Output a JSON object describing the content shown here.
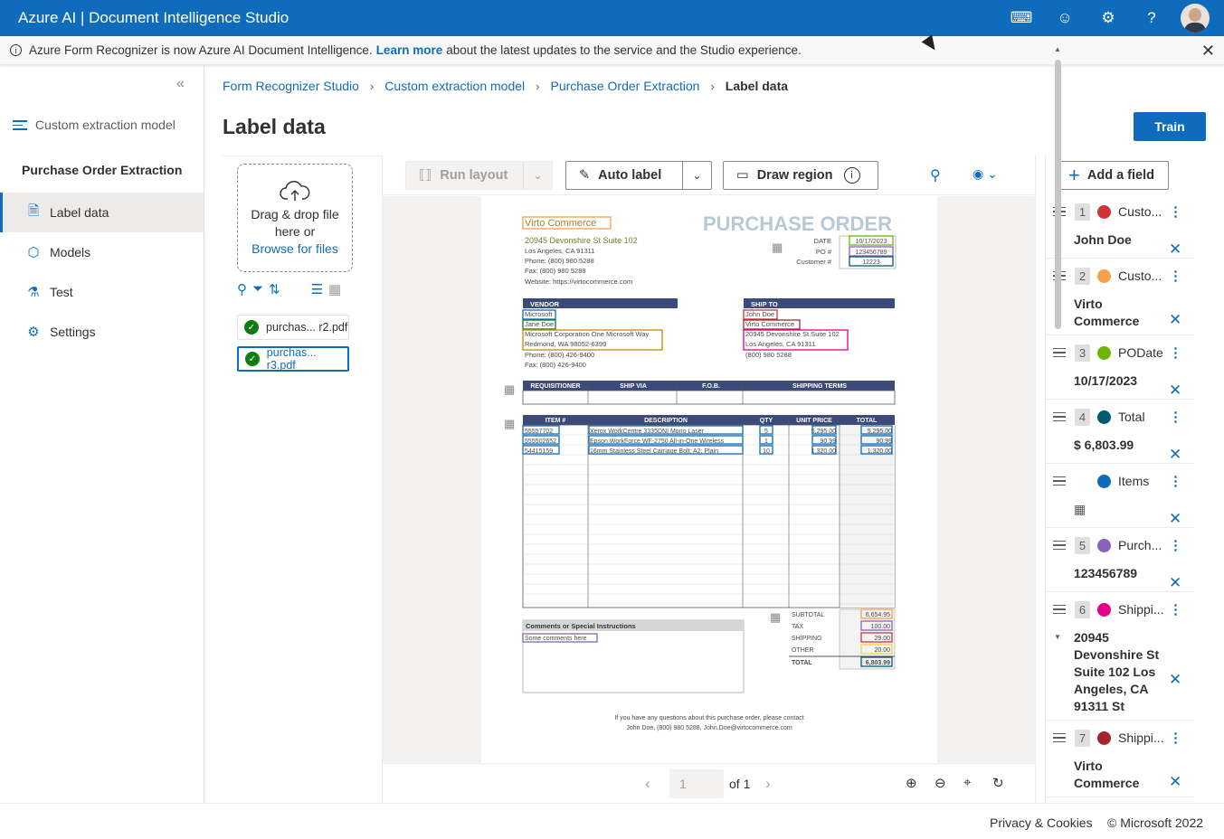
{
  "app": {
    "title": "Azure AI | Document Intelligence Studio"
  },
  "banner": {
    "text_before": "Azure Form Recognizer is now Azure AI Document Intelligence.",
    "link": "Learn more",
    "text_after": "about the latest updates to the service and the Studio experience."
  },
  "nav": {
    "model_type": "Custom extraction model",
    "project": "Purchase Order Extraction",
    "items": [
      {
        "label": "Label data",
        "icon": "document-icon",
        "active": true
      },
      {
        "label": "Models",
        "icon": "cube-icon",
        "active": false
      },
      {
        "label": "Test",
        "icon": "flask-icon",
        "active": false
      },
      {
        "label": "Settings",
        "icon": "gear-icon",
        "active": false
      }
    ]
  },
  "breadcrumb": [
    "Form Recognizer Studio",
    "Custom extraction model",
    "Purchase Order Extraction",
    "Label data"
  ],
  "page": {
    "title": "Label data",
    "train_label": "Train"
  },
  "upload": {
    "line1": "Drag & drop file",
    "line2": "here or",
    "browse": "Browse for files"
  },
  "files": [
    {
      "name": "purchas... r2.pdf",
      "selected": false
    },
    {
      "name": "purchas... r3.pdf",
      "selected": true
    }
  ],
  "toolbar": {
    "run_layout": "Run layout",
    "auto_label": "Auto label",
    "draw_region": "Draw region"
  },
  "pager": {
    "current": "1",
    "of_label": "of 1"
  },
  "fields": {
    "add_label": "Add a field",
    "items": [
      {
        "num": "1",
        "name": "Custo...",
        "color": "#d13438",
        "value": "John Doe"
      },
      {
        "num": "2",
        "name": "Custo...",
        "color": "#f7a14a",
        "value": "Virto Commerce"
      },
      {
        "num": "3",
        "name": "PODate",
        "color": "#6bb700",
        "value": "10/17/2023"
      },
      {
        "num": "4",
        "name": "Total",
        "color": "#005b70",
        "value": "$ 6,803.99"
      },
      {
        "num": "",
        "name": "Items",
        "color": "#0f6cbd",
        "value": ""
      },
      {
        "num": "5",
        "name": "Purch...",
        "color": "#8764b8",
        "value": "123456789"
      },
      {
        "num": "6",
        "name": "Shippi...",
        "color": "#e3008c",
        "value": "20945 Devonshire St Suite 102 Los Angeles, CA 91311 St"
      },
      {
        "num": "7",
        "name": "Shippi...",
        "color": "#a4262c",
        "value": "Virto Commerce"
      }
    ]
  },
  "document": {
    "company": "Virto Commerce",
    "heading": "PURCHASE ORDER",
    "address": [
      "20945 Devonshire St Suite 102",
      "Los Angeles, CA 91311",
      "Phone: (800) 980 5288",
      "Fax: (800) 980 5288",
      "Website: https://virtocommerce.com"
    ],
    "meta_labels": [
      "DATE",
      "PO #",
      "Customer #"
    ],
    "meta_values": [
      "10/17/2023",
      "123456789",
      "12223"
    ],
    "vendor_header": "VENDOR",
    "vendor": [
      "Microsoft",
      "Jane Doe",
      "Microsoft Corporation One Microsoft Way",
      "Redmond, WA 98052-6399",
      "Phone: (800) 426-9400",
      "Fax: (800) 426-9400"
    ],
    "shipto_header": "SHIP TO",
    "shipto": [
      "John Doe",
      "Virto Commerce",
      "20945 Devonshire St Suite 102",
      "Los Angeles, CA 91311",
      "(800) 980 5288"
    ],
    "ship_headers": [
      "REQUISITIONER",
      "SHIP VIA",
      "F.O.B.",
      "SHIPPING TERMS"
    ],
    "item_headers": [
      "ITEM #",
      "DESCRIPTION",
      "QTY",
      "UNIT PRICE",
      "TOTAL"
    ],
    "items": [
      [
        "55557702",
        "Xerox WorkCentre 3335DNI Mono Laser",
        "5",
        "5,295.00",
        "5,295.00"
      ],
      [
        "555502652",
        "Epson WorkForce WF-2750 All-in-One Wireless",
        "1",
        "90.99",
        "90.99"
      ],
      [
        "54415159",
        "16mm Stainless Steel Carriage Bolt; A2; Plain",
        "10",
        "1,320.00",
        "1,320.00"
      ]
    ],
    "totals_labels": [
      "SUBTOTAL",
      "TAX",
      "SHIPPING",
      "OTHER",
      "TOTAL"
    ],
    "totals_values": [
      "6,654.95",
      "100.00",
      "29.00",
      "20.00",
      "6,803.99"
    ],
    "comments_header": "Comments or Special Instructions",
    "comments": "Some comments here",
    "footer": [
      "If you have any questions about this purchase order, please contact",
      "John Doe, (800) 980 5288, John.Doe@virtocommerce.com"
    ]
  },
  "footer": {
    "privacy": "Privacy & Cookies",
    "copyright": "© Microsoft 2022"
  }
}
